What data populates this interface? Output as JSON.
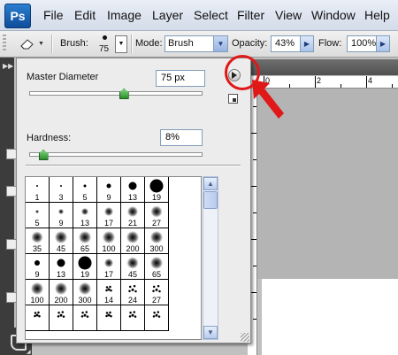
{
  "app": {
    "logo": "Ps"
  },
  "menu": [
    "File",
    "Edit",
    "Image",
    "Layer",
    "Select",
    "Filter",
    "View",
    "Window",
    "Help"
  ],
  "options": {
    "brush_label": "Brush:",
    "brush_size": "75",
    "mode_label": "Mode:",
    "mode_value": "Brush",
    "opacity_label": "Opacity:",
    "opacity_value": "43%",
    "flow_label": "Flow:",
    "flow_value": "100%"
  },
  "ruler": {
    "labels": [
      "0",
      "2",
      "4"
    ]
  },
  "picker": {
    "master_diameter_label": "Master Diameter",
    "master_diameter_value": "75 px",
    "master_diameter_level": 0.55,
    "hardness_label": "Hardness:",
    "hardness_value": "8%",
    "hardness_level": 0.08,
    "presets": [
      {
        "label": "1",
        "kind": "hard",
        "size": 2
      },
      {
        "label": "3",
        "kind": "hard",
        "size": 2
      },
      {
        "label": "5",
        "kind": "hard",
        "size": 3
      },
      {
        "label": "9",
        "kind": "hard",
        "size": 5
      },
      {
        "label": "13",
        "kind": "hard",
        "size": 9
      },
      {
        "label": "19",
        "kind": "hard",
        "size": 15
      },
      {
        "label": "5",
        "kind": "soft",
        "size": 4
      },
      {
        "label": "9",
        "kind": "soft",
        "size": 6
      },
      {
        "label": "13",
        "kind": "soft",
        "size": 8
      },
      {
        "label": "17",
        "kind": "soft",
        "size": 10
      },
      {
        "label": "21",
        "kind": "soft",
        "size": 12
      },
      {
        "label": "27",
        "kind": "soft",
        "size": 13
      },
      {
        "label": "35",
        "kind": "soft",
        "size": 13
      },
      {
        "label": "45",
        "kind": "soft",
        "size": 14
      },
      {
        "label": "65",
        "kind": "soft",
        "size": 14
      },
      {
        "label": "100",
        "kind": "soft",
        "size": 14
      },
      {
        "label": "200",
        "kind": "soft",
        "size": 14
      },
      {
        "label": "300",
        "kind": "soft",
        "size": 14
      },
      {
        "label": "9",
        "kind": "hard",
        "size": 6
      },
      {
        "label": "13",
        "kind": "hard",
        "size": 9
      },
      {
        "label": "19",
        "kind": "hard",
        "size": 15
      },
      {
        "label": "17",
        "kind": "soft",
        "size": 10
      },
      {
        "label": "45",
        "kind": "soft",
        "size": 13
      },
      {
        "label": "65",
        "kind": "soft",
        "size": 14
      },
      {
        "label": "100",
        "kind": "soft",
        "size": 14
      },
      {
        "label": "200",
        "kind": "soft",
        "size": 14
      },
      {
        "label": "300",
        "kind": "soft",
        "size": 14
      },
      {
        "label": "14",
        "kind": "spatter",
        "size": 10
      },
      {
        "label": "24",
        "kind": "spatter",
        "size": 14
      },
      {
        "label": "27",
        "kind": "spatter",
        "size": 14
      },
      {
        "label": "",
        "kind": "spatter",
        "size": 10
      },
      {
        "label": "",
        "kind": "spatter",
        "size": 12
      },
      {
        "label": "",
        "kind": "spatter",
        "size": 12
      },
      {
        "label": "",
        "kind": "spatter",
        "size": 10
      },
      {
        "label": "",
        "kind": "spatter",
        "size": 12
      },
      {
        "label": "",
        "kind": "spatter",
        "size": 12
      }
    ]
  },
  "colors": {
    "annotation": "#e01818",
    "thumb": "#2d8f2d"
  }
}
